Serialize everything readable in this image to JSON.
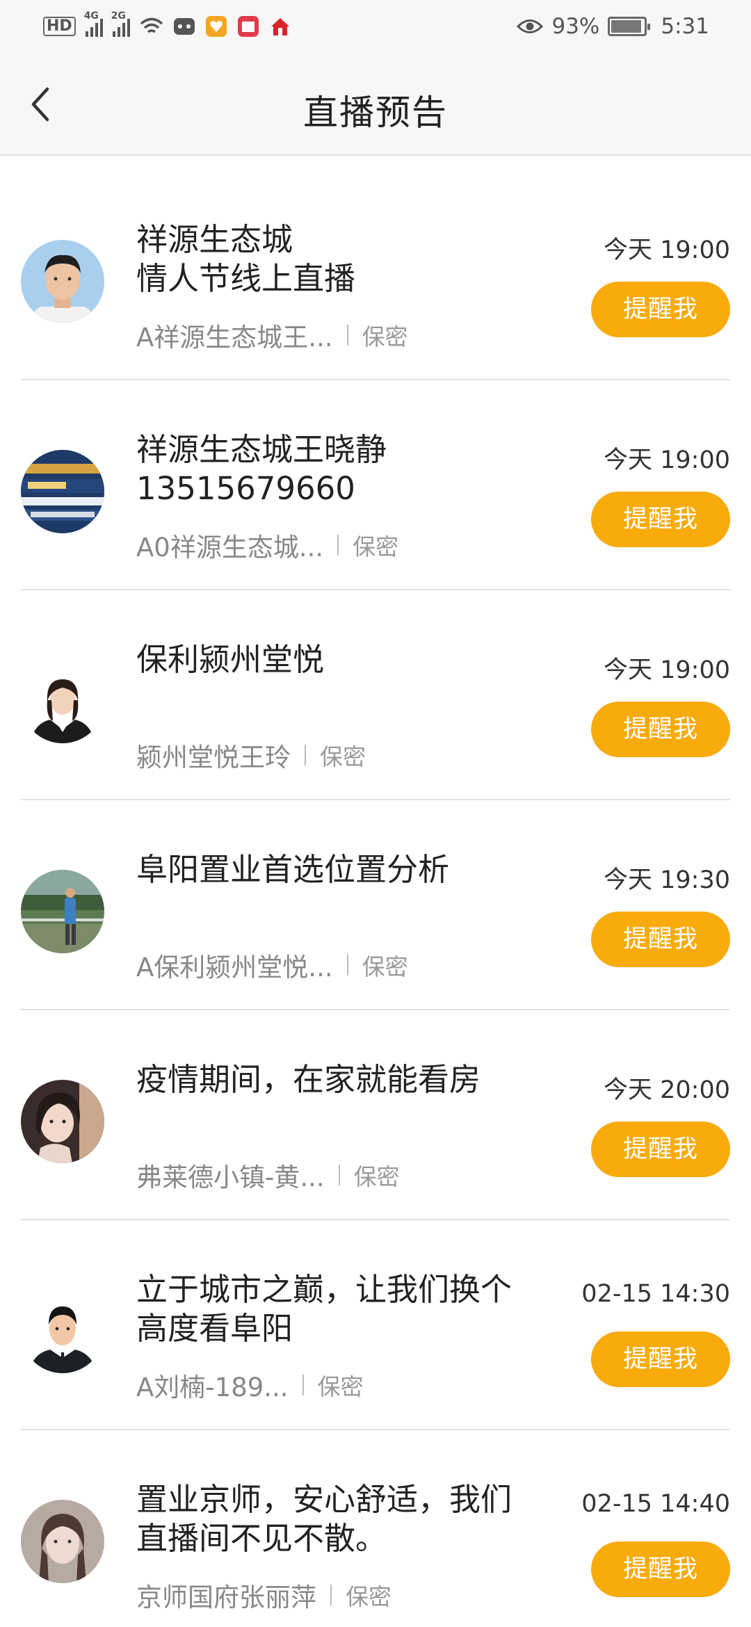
{
  "status_bar": {
    "hd": "HD",
    "net1": "4G",
    "net2": "2G",
    "battery_percent": "93%",
    "battery_level": 0.93,
    "time": "5:31",
    "icons": [
      "signal-icon",
      "wifi-icon",
      "game-icon",
      "heart-app-icon",
      "calendar-app-icon",
      "home-app-icon",
      "eye-icon",
      "battery-icon"
    ]
  },
  "header": {
    "title": "直播预告",
    "back_icon": "chevron-left-icon"
  },
  "button_label": "提醒我",
  "items": [
    {
      "title": "祥源生态城\n情人节线上直播",
      "author": "A祥源生态城王...",
      "privacy": "保密",
      "time": "今天  19:00",
      "avatar": "man-portrait"
    },
    {
      "title": "祥源生态城王晓静\n13515679660",
      "author": "A0祥源生态城...",
      "privacy": "保密",
      "time": "今天  19:00",
      "avatar": "billboard"
    },
    {
      "title": "保利颍州堂悦",
      "author": "颍州堂悦王玲",
      "privacy": "保密",
      "time": "今天  19:00",
      "avatar": "woman-suit"
    },
    {
      "title": "阜阳置业首选位置分析",
      "author": "A保利颍州堂悦...",
      "privacy": "保密",
      "time": "今天  19:30",
      "avatar": "outdoor-man"
    },
    {
      "title": "疫情期间，在家就能看房",
      "author": "弗莱德小镇-黄...",
      "privacy": "保密",
      "time": "今天  20:00",
      "avatar": "woman-hair"
    },
    {
      "title": "立于城市之巅，让我们换个\n高度看阜阳",
      "author": "A刘楠-189...",
      "privacy": "保密",
      "time": "02-15  14:30",
      "avatar": "man-suit"
    },
    {
      "title": "置业京师，安心舒适，我们\n直播间不见不散。",
      "author": "京师国府张丽萍",
      "privacy": "保密",
      "time": "02-15  14:40",
      "avatar": "woman-face"
    }
  ]
}
